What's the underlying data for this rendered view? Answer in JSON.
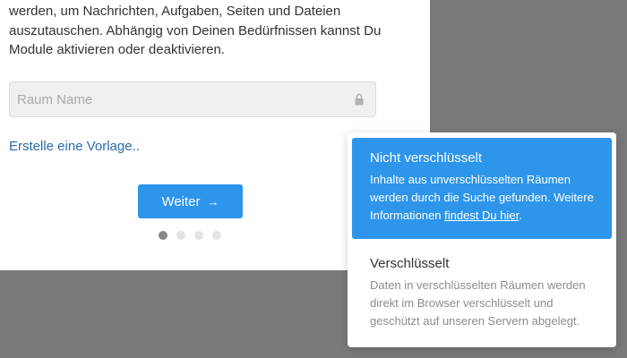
{
  "modal": {
    "intro_text": "werden, um Nachrichten, Aufgaben, Seiten und Dateien auszutauschen. Abhängig von Deinen Bedürfnissen kannst Du Module aktivieren oder deaktivieren.",
    "name_input": {
      "placeholder": "Raum Name",
      "value": "",
      "icon": "lock-icon"
    },
    "template_link": "Erstelle eine Vorlage..",
    "next_button": {
      "label": "Weiter",
      "arrow": "→"
    },
    "steps": {
      "total": 4,
      "current": 1
    }
  },
  "encryption_dropdown": {
    "options": [
      {
        "title": "Nicht verschlüsselt",
        "description": "Inhalte aus unverschlüsselten Räumen werden durch die Suche gefunden. Weitere Informationen",
        "link_text": "findest Du hier",
        "suffix": ".",
        "selected": true
      },
      {
        "title": "Verschlüsselt",
        "description": "Daten in verschlüsselten Räumen werden direkt im Browser verschlüsselt und geschützt auf unseren Servern abgelegt.",
        "selected": false
      }
    ]
  },
  "colors": {
    "accent": "#2d95ea",
    "link": "#2a6bb0",
    "overlay": "#7a7a7a",
    "input_bg": "#f0f0f0"
  }
}
